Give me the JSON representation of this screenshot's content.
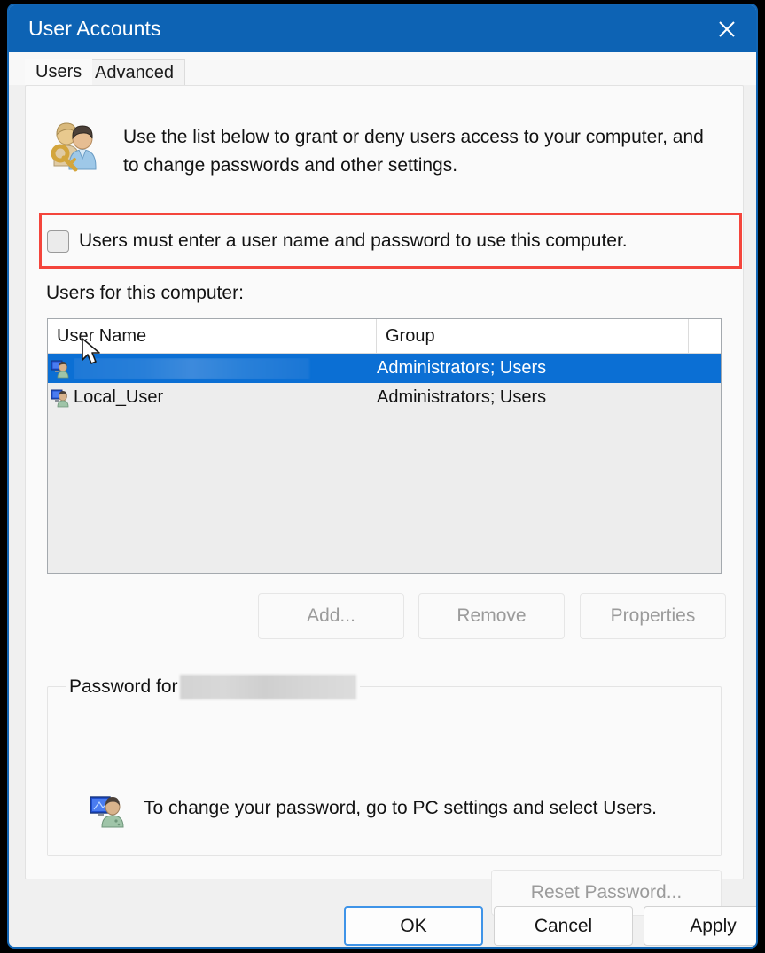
{
  "window": {
    "title": "User Accounts",
    "close_label": "Close",
    "close_icon": "close-icon",
    "accent_color": "#0d63b4",
    "border_color": "#1266b5"
  },
  "tabs": [
    {
      "label": "Users",
      "active": true
    },
    {
      "label": "Advanced",
      "active": false
    }
  ],
  "header": {
    "icon": "users-key-icon",
    "description": "Use the list below to grant or deny users access to your computer, and to change passwords and other settings."
  },
  "checkbox": {
    "icon": "checkbox-unchecked-icon",
    "label": "Users must enter a user name and password to use this computer.",
    "checked": false
  },
  "annotation": {
    "color": "#f4453c",
    "shape": "rectangle-highlight"
  },
  "cursor": {
    "icon": "mouse-pointer-icon"
  },
  "list": {
    "label": "Users for this computer:",
    "columns": [
      "User Name",
      "Group",
      ""
    ],
    "rows": [
      {
        "icon": "user-account-icon",
        "user_name": "",
        "user_name_redacted": true,
        "group": "Administrators; Users",
        "selected": true
      },
      {
        "icon": "user-account-icon",
        "user_name": "Local_User",
        "user_name_redacted": false,
        "group": "Administrators; Users",
        "selected": false
      }
    ],
    "selection_color": "#0b6fd4"
  },
  "list_buttons": [
    {
      "label": "Add...",
      "enabled": false
    },
    {
      "label": "Remove",
      "enabled": false
    },
    {
      "label": "Properties",
      "enabled": false
    }
  ],
  "password_group": {
    "legend_prefix": "Password for",
    "legend_redacted": true,
    "icon": "user-monitor-icon",
    "text": "To change your password, go to PC settings and select Users.",
    "reset_button": {
      "label": "Reset Password...",
      "enabled": false
    }
  },
  "footer_buttons": [
    {
      "label": "OK",
      "style": "default"
    },
    {
      "label": "Cancel",
      "style": "normal"
    },
    {
      "label": "Apply",
      "style": "normal"
    }
  ]
}
